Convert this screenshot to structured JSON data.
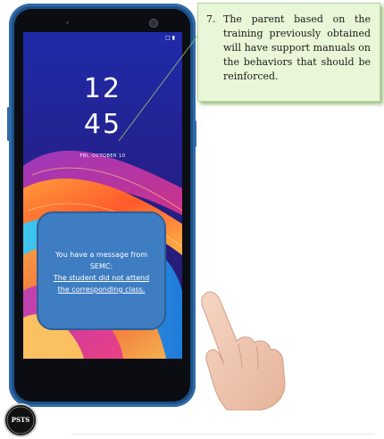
{
  "phone": {
    "status_icons": "□ ▮",
    "clock": {
      "hour": "12",
      "minute": "45"
    },
    "date": "FRI, OCTOBER 10"
  },
  "notification": {
    "line1": "You have a message from",
    "line2": "SEMC:",
    "link_line1": "The student did not attend",
    "link_line2": "the corresponding class."
  },
  "callout": {
    "number": "7.",
    "text": "The parent based on the training previously obtained will have support manuals on the behaviors that should be reinforced."
  },
  "logo": {
    "text": "PSTS"
  },
  "colors": {
    "phone_body": "#1e4f86",
    "notification_bg": "#3f7dc2",
    "callout_bg": "#e9f6d7",
    "wallpaper_base": "#1a1880"
  },
  "icons": [
    "hand-pointing-icon",
    "front-camera-icon",
    "logo-badge"
  ]
}
